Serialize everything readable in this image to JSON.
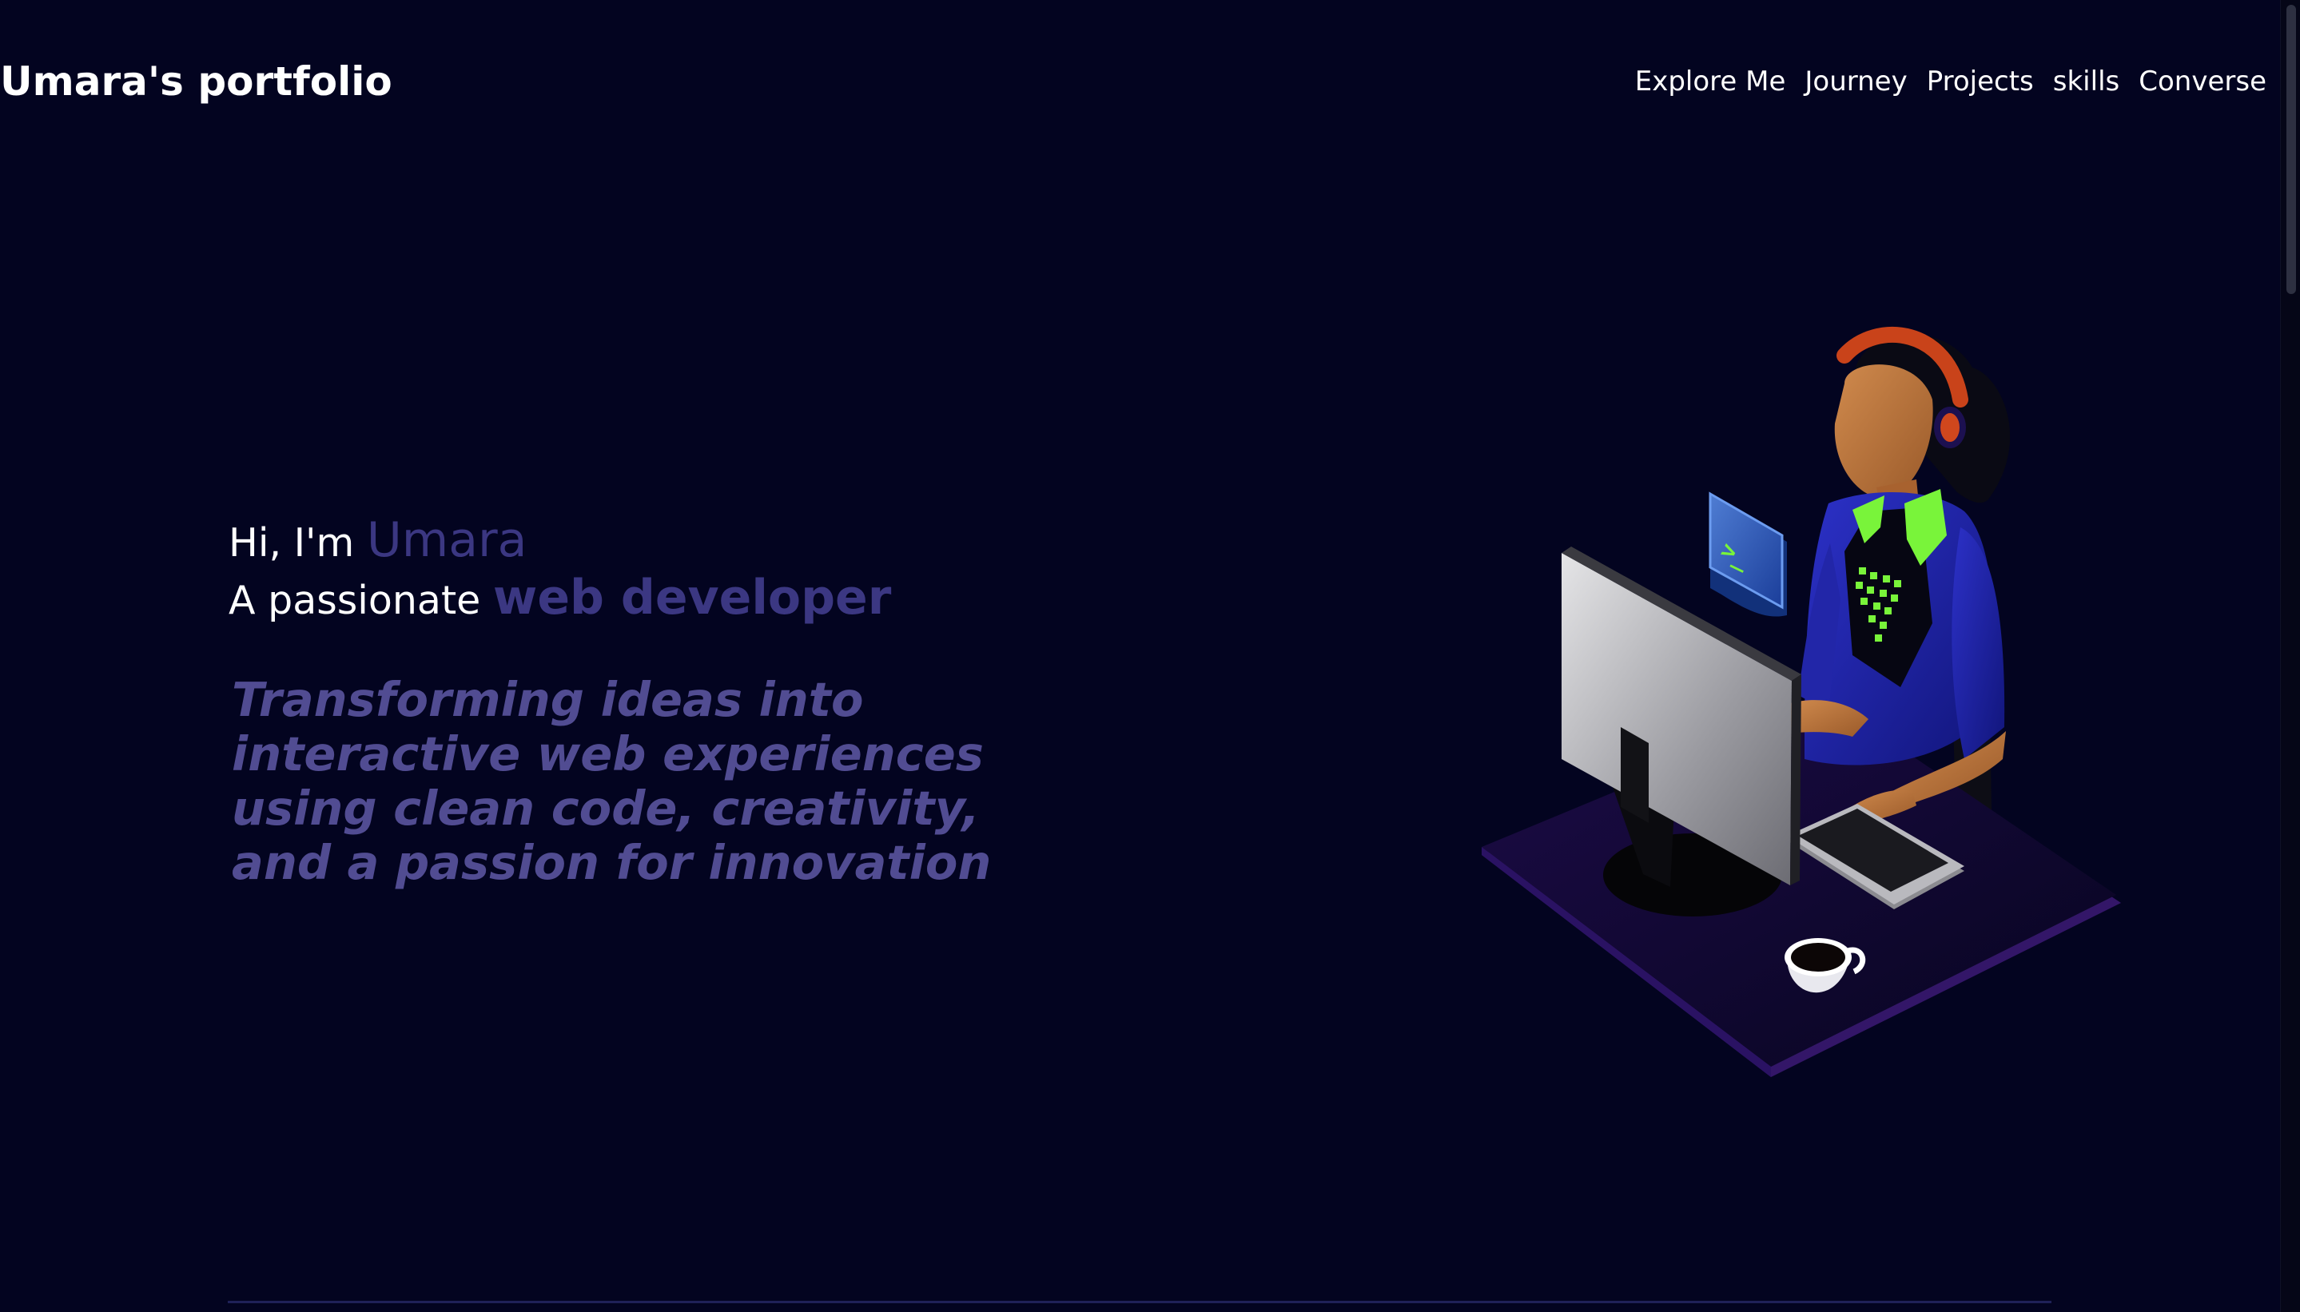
{
  "header": {
    "brand": "Umara's portfolio",
    "nav": [
      {
        "label": "Explore Me"
      },
      {
        "label": "Journey"
      },
      {
        "label": "Projects"
      },
      {
        "label": "skills"
      },
      {
        "label": "Converse"
      }
    ]
  },
  "hero": {
    "greeting_prefix": "Hi, I'm",
    "name": "Umara",
    "role_prefix": "A passionate",
    "role": "web developer",
    "tagline": "Transforming ideas into interactive web experiences using clean code, creativity, and a passion for innovation"
  },
  "illustration": {
    "terminal_icon_text": ">_",
    "colors": {
      "background": "#030420",
      "accent": "#3b3782",
      "tagline": "#514c92",
      "jacket": "#2b2fb8",
      "collar": "#79f43a",
      "headphones": "#c9431a",
      "monitor": "#cfcfd1",
      "desk": "#160a37"
    }
  }
}
